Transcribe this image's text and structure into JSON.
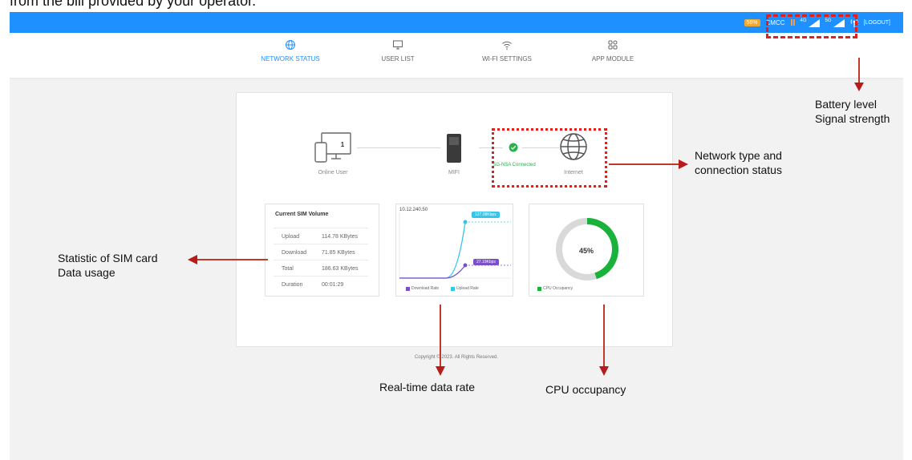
{
  "caption": {
    "top": "from the bill provided by your operator."
  },
  "topbar": {
    "battery": "56%",
    "operator": "CMCC",
    "net_4g": "4G",
    "net_5g": "5G",
    "logout": "[LOGOUT]"
  },
  "nav": {
    "items": [
      {
        "label": "NETWORK STATUS",
        "icon": "globe-icon",
        "active": true
      },
      {
        "label": "USER LIST",
        "icon": "monitor-icon",
        "active": false
      },
      {
        "label": "WI-FI SETTINGS",
        "icon": "wifi-icon",
        "active": false
      },
      {
        "label": "APP MODULE",
        "icon": "app-grid-icon",
        "active": false
      }
    ]
  },
  "network": {
    "online_user": "Online User",
    "online_count": "1",
    "mifi": "MIFI",
    "connection": "5G-NSA Connected",
    "internet": "Internet"
  },
  "sim_volume": {
    "title": "Current SIM Volume",
    "rows": [
      {
        "label": "Upload",
        "value": "114.78 KBytes"
      },
      {
        "label": "Download",
        "value": "71.85 KBytes"
      },
      {
        "label": "Total",
        "value": "186.63 KBytes"
      },
      {
        "label": "Duration",
        "value": "00:01:29"
      }
    ]
  },
  "data_rate": {
    "ip": "10.12.240.50",
    "upload_badge": "127.08Kbps",
    "download_badge": "27.19Kbps",
    "legend_download": "Download Rate",
    "legend_upload": "Upload Rate"
  },
  "cpu": {
    "value": "45%",
    "fraction": 0.45,
    "legend": "CPU Occupancy"
  },
  "footer": {
    "copyright": "Copyright © 2023. All Rights Reserved."
  },
  "annotations": {
    "battery": "Battery level",
    "signal": "Signal strength",
    "network_1": "Network type and",
    "network_2": "connection status",
    "sim_1": "Statistic of SIM card",
    "sim_2": "Data usage",
    "rate": "Real-time data rate",
    "cpu": "CPU occupancy"
  },
  "colors": {
    "accent": "#1e90ff",
    "connected": "#27b24a",
    "cpu_ring": "#19b23b",
    "upload_line": "#33c6e8",
    "download_line": "#7b4fc9",
    "annotation_red": "#c0392b"
  }
}
